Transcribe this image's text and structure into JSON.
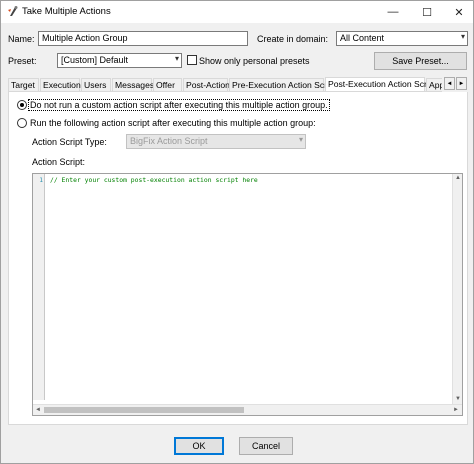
{
  "window": {
    "title": "Take Multiple Actions",
    "minimize_glyph": "—",
    "maximize_glyph": "☐",
    "close_glyph": "✕"
  },
  "form": {
    "name_label": "Name:",
    "name_value": "Multiple Action Group",
    "domain_label": "Create in domain:",
    "domain_value": "All Content",
    "preset_label": "Preset:",
    "preset_value": "[Custom] Default",
    "show_personal_label": "Show only personal presets",
    "save_preset_label": "Save Preset..."
  },
  "tabs": [
    {
      "label": "Target"
    },
    {
      "label": "Execution"
    },
    {
      "label": "Users"
    },
    {
      "label": "Messages"
    },
    {
      "label": "Offer"
    },
    {
      "label": "Post-Action"
    },
    {
      "label": "Pre-Execution Action Script"
    },
    {
      "label": "Post-Execution Action Script"
    },
    {
      "label": "Appl"
    }
  ],
  "tab_scroll": {
    "left": "◄",
    "right": "►"
  },
  "panel": {
    "radio_none_label": "Do not run a custom action script after executing this multiple action group.",
    "radio_run_label": "Run the following action script after executing this multiple action group:",
    "script_type_label": "Action Script Type:",
    "script_type_value": "BigFix Action Script",
    "script_label": "Action Script:",
    "line_number": "1",
    "code_text": "// Enter your custom post-execution action script here"
  },
  "footer": {
    "ok_label": "OK",
    "cancel_label": "Cancel"
  },
  "icons": {
    "dropdown": "▾",
    "scroll_up": "▲",
    "scroll_down": "▼",
    "scroll_left": "◄",
    "scroll_right": "►"
  }
}
